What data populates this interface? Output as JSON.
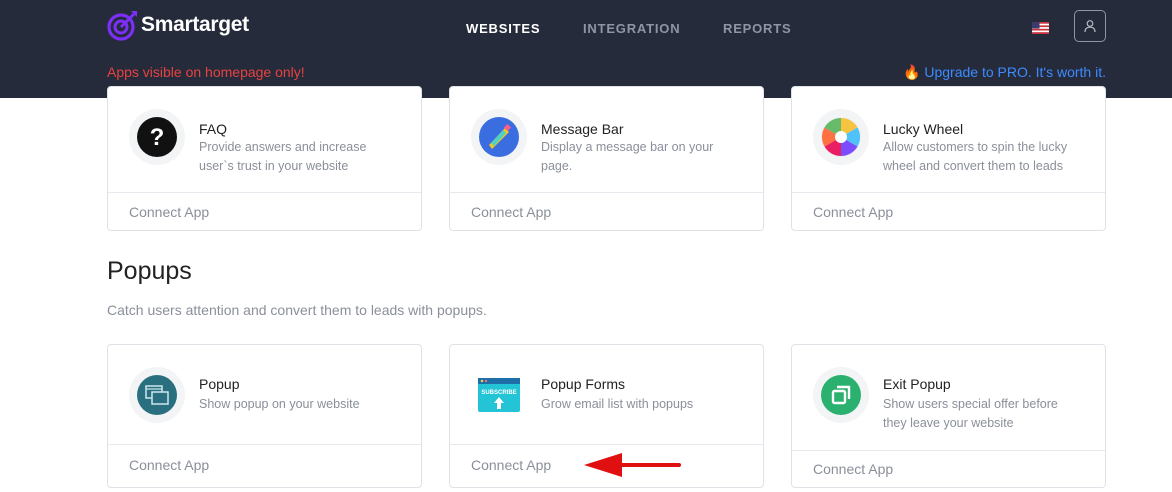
{
  "brand": {
    "name": "Smartarget",
    "accent": "#7b2ff7"
  },
  "nav": {
    "items": [
      {
        "label": "WEBSITES",
        "active": true
      },
      {
        "label": "INTEGRATION",
        "active": false
      },
      {
        "label": "REPORTS",
        "active": false
      }
    ]
  },
  "header": {
    "notice": "Apps visible on homepage only!",
    "upgrade": "🔥 Upgrade to PRO. It's worth it.",
    "flag_icon": "us-flag-icon",
    "user_icon": "user-icon"
  },
  "apps_top": [
    {
      "title": "FAQ",
      "desc": "Provide answers and increase user`s trust in your website",
      "action": "Connect App",
      "icon": "question-icon"
    },
    {
      "title": "Message Bar",
      "desc": "Display a message bar on your page.",
      "action": "Connect App",
      "icon": "megaphone-icon"
    },
    {
      "title": "Lucky Wheel",
      "desc": "Allow customers to spin the lucky wheel and convert them to leads",
      "action": "Connect App",
      "icon": "wheel-icon"
    }
  ],
  "popups_section": {
    "title": "Popups",
    "subtitle": "Catch users attention and convert them to leads with popups."
  },
  "apps_popups": [
    {
      "title": "Popup",
      "desc": "Show popup on your website",
      "action": "Connect App",
      "icon": "windows-icon"
    },
    {
      "title": "Popup Forms",
      "desc": "Grow email list with popups",
      "action": "Connect App",
      "icon": "subscribe-icon",
      "icon_text": "SUBSCRIBE"
    },
    {
      "title": "Exit Popup",
      "desc": "Show users special offer before they leave your website",
      "action": "Connect App",
      "icon": "exit-icon"
    }
  ],
  "annotation": {
    "color": "#e01010",
    "icon": "red-arrow-icon"
  }
}
